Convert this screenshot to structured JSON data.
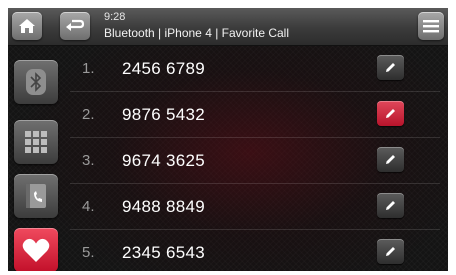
{
  "header": {
    "time": "9:28",
    "breadcrumb": "Bluetooth | iPhone 4 | Favorite Call",
    "home_icon": "home-icon",
    "back_icon": "back-arrow-icon",
    "menu_icon": "hamburger-menu-icon"
  },
  "sidebar": {
    "items": [
      {
        "icon": "bluetooth-icon",
        "active": false
      },
      {
        "icon": "keypad-icon",
        "active": false
      },
      {
        "icon": "phonebook-icon",
        "active": false
      },
      {
        "icon": "heart-icon",
        "active": true
      }
    ]
  },
  "favorites": [
    {
      "index": "1.",
      "number": "2456 6789",
      "edit_active": false
    },
    {
      "index": "2.",
      "number": "9876 5432",
      "edit_active": true
    },
    {
      "index": "3.",
      "number": "9674 3625",
      "edit_active": false
    },
    {
      "index": "4.",
      "number": "9488 8849",
      "edit_active": false
    },
    {
      "index": "5.",
      "number": "2345 6543",
      "edit_active": false
    }
  ],
  "colors": {
    "accent": "#d42a3f",
    "topbar": "#3b3b3b",
    "background": "#141414"
  }
}
